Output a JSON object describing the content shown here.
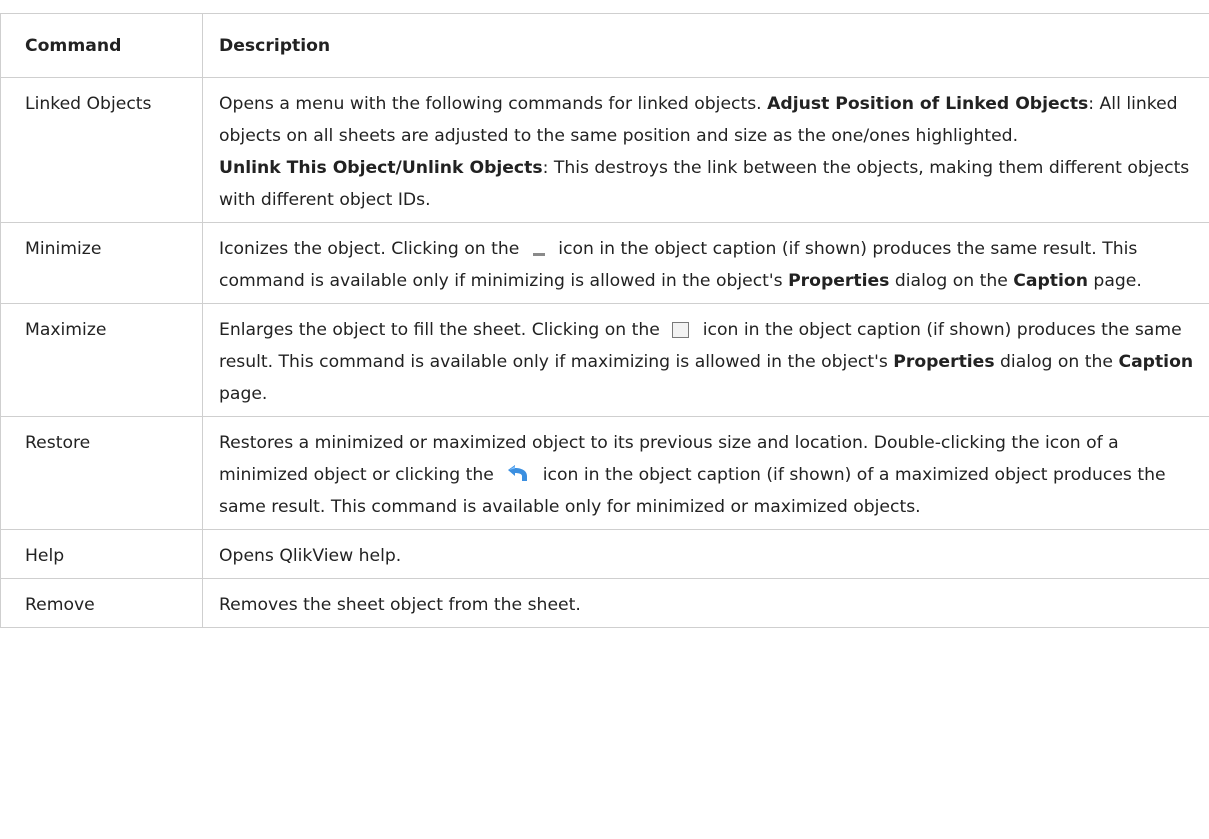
{
  "table": {
    "headers": {
      "command": "Command",
      "description": "Description"
    },
    "rows": [
      {
        "command": "Linked Objects",
        "desc_1": "Opens a menu with the following commands for linked objects. ",
        "bold_1": "Adjust Position of Linked Objects",
        "desc_2": ": All linked objects on all sheets are adjusted to the same position and size as the one/ones highlighted.",
        "bold_2": "Unlink This Object/Unlink Objects",
        "desc_3": ": This destroys the link between the objects, making them different objects with different object IDs."
      },
      {
        "command": "Minimize",
        "desc_1": "Iconizes the object. Clicking on the ",
        "icon": "minimize-icon",
        "desc_2": " icon in the object caption (if shown) produces the same result. This command is available only if minimizing is allowed in the object's ",
        "bold_1": "Properties",
        "desc_3": " dialog on the ",
        "bold_2": "Caption",
        "desc_4": " page."
      },
      {
        "command": "Maximize",
        "desc_1": "Enlarges the object to fill the sheet. Clicking on the ",
        "icon": "maximize-icon",
        "desc_2": " icon in the object caption (if shown) produces the same result. This command is available only if maximizing is allowed in the object's ",
        "bold_1": "Properties",
        "desc_3": " dialog on the ",
        "bold_2": "Caption",
        "desc_4": " page."
      },
      {
        "command": "Restore",
        "desc_1": "Restores a minimized or maximized object to its previous size and location. Double-clicking the icon of a minimized object or clicking the ",
        "icon": "restore-icon",
        "desc_2": " icon in the object caption (if shown) of a maximized object produces the same result. This command is available only for minimized or maximized objects."
      },
      {
        "command": "Help",
        "desc_1": "Opens QlikView help."
      },
      {
        "command": "Remove",
        "desc_1": "Removes the sheet object from the sheet."
      }
    ]
  },
  "colors": {
    "border": "#cfcfcf",
    "text": "#222222",
    "restore_icon_blue": "#3b8fe0"
  }
}
